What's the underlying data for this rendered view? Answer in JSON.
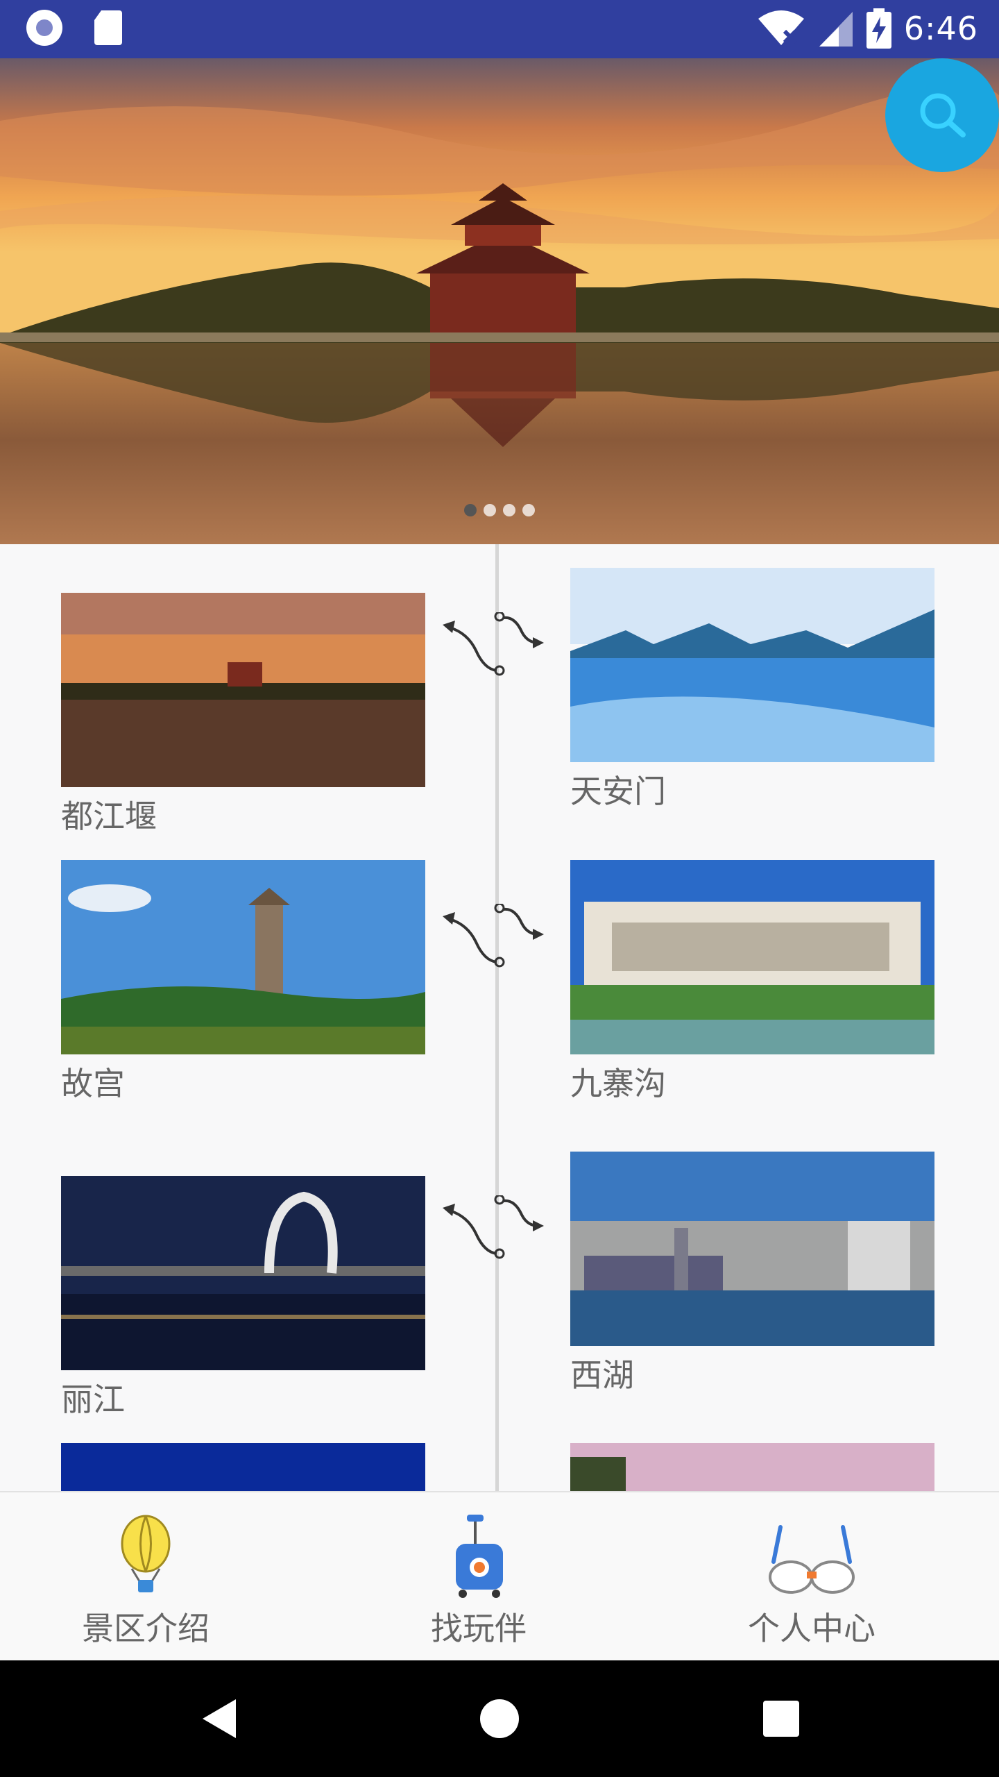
{
  "status_bar": {
    "time": "6:46",
    "left_icons": [
      "circle-app-icon",
      "sd-card-icon"
    ],
    "right_icons": [
      "wifi-off-icon",
      "cell-signal-icon",
      "battery-charging-icon"
    ]
  },
  "hero": {
    "slide_count": 4,
    "active_slide": 1,
    "search_icon": "search-icon",
    "colors": {
      "search_fab": "#1aa6e0"
    }
  },
  "spots": [
    {
      "name": "都江堰",
      "side": "left"
    },
    {
      "name": "天安门",
      "side": "right"
    },
    {
      "name": "故宫",
      "side": "left"
    },
    {
      "name": "九寨沟",
      "side": "right"
    },
    {
      "name": "丽江",
      "side": "left"
    },
    {
      "name": "西湖",
      "side": "right"
    }
  ],
  "tabs": [
    {
      "label": "景区介绍",
      "icon": "hot-air-balloon-icon"
    },
    {
      "label": "找玩伴",
      "icon": "luggage-icon"
    },
    {
      "label": "个人中心",
      "icon": "glasses-icon"
    }
  ],
  "nav_bar": {
    "icons": [
      "back-icon",
      "home-icon",
      "recents-icon"
    ]
  }
}
